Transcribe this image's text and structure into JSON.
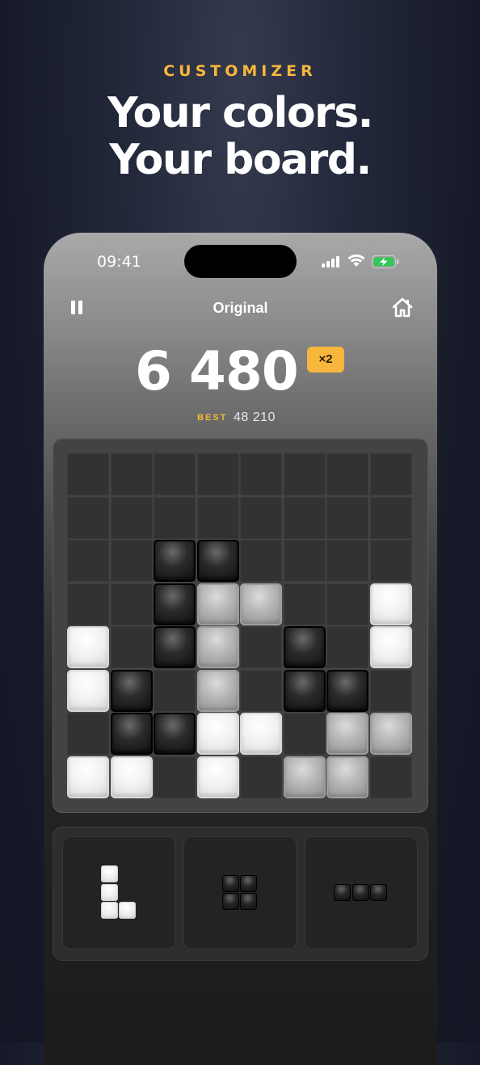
{
  "promo": {
    "eyebrow": "CUSTOMIZER",
    "headline_line1": "Your colors.",
    "headline_line2": "Your board."
  },
  "status_bar": {
    "time": "09:41",
    "icons": [
      "cellular-signal-icon",
      "wifi-icon",
      "battery-charging-icon"
    ]
  },
  "game": {
    "mode_title": "Original",
    "score": "6 480",
    "multiplier": "×2",
    "best_label": "BEST",
    "best_value": "48 210",
    "grid_size": 8,
    "board": [
      [
        ".",
        ".",
        ".",
        ".",
        ".",
        ".",
        ".",
        "."
      ],
      [
        ".",
        ".",
        ".",
        ".",
        ".",
        ".",
        ".",
        "."
      ],
      [
        ".",
        ".",
        "D",
        "D",
        ".",
        ".",
        ".",
        "."
      ],
      [
        ".",
        ".",
        "D",
        "G",
        "G",
        ".",
        ".",
        "W"
      ],
      [
        "W",
        ".",
        "D",
        "G",
        ".",
        "D",
        ".",
        "W"
      ],
      [
        "W",
        "D",
        ".",
        "G",
        ".",
        "D",
        "D",
        "."
      ],
      [
        ".",
        "D",
        "D",
        "W",
        "W",
        ".",
        "G",
        "G"
      ],
      [
        "W",
        "W",
        ".",
        "W",
        ".",
        "G",
        "G",
        "."
      ]
    ],
    "pieces": [
      {
        "color": "white",
        "shape": [
          [
            1,
            0
          ],
          [
            1,
            0
          ],
          [
            1,
            1
          ]
        ]
      },
      {
        "color": "dark",
        "shape": [
          [
            1,
            1
          ],
          [
            1,
            1
          ]
        ]
      },
      {
        "color": "dark",
        "shape": [
          [
            1,
            1,
            1
          ]
        ]
      }
    ],
    "colors": {
      "accent": "#f6b73c",
      "dark_block": "#1a1a1a",
      "grey_block": "#b5b5b5",
      "white_block": "#f1f1f1"
    }
  }
}
